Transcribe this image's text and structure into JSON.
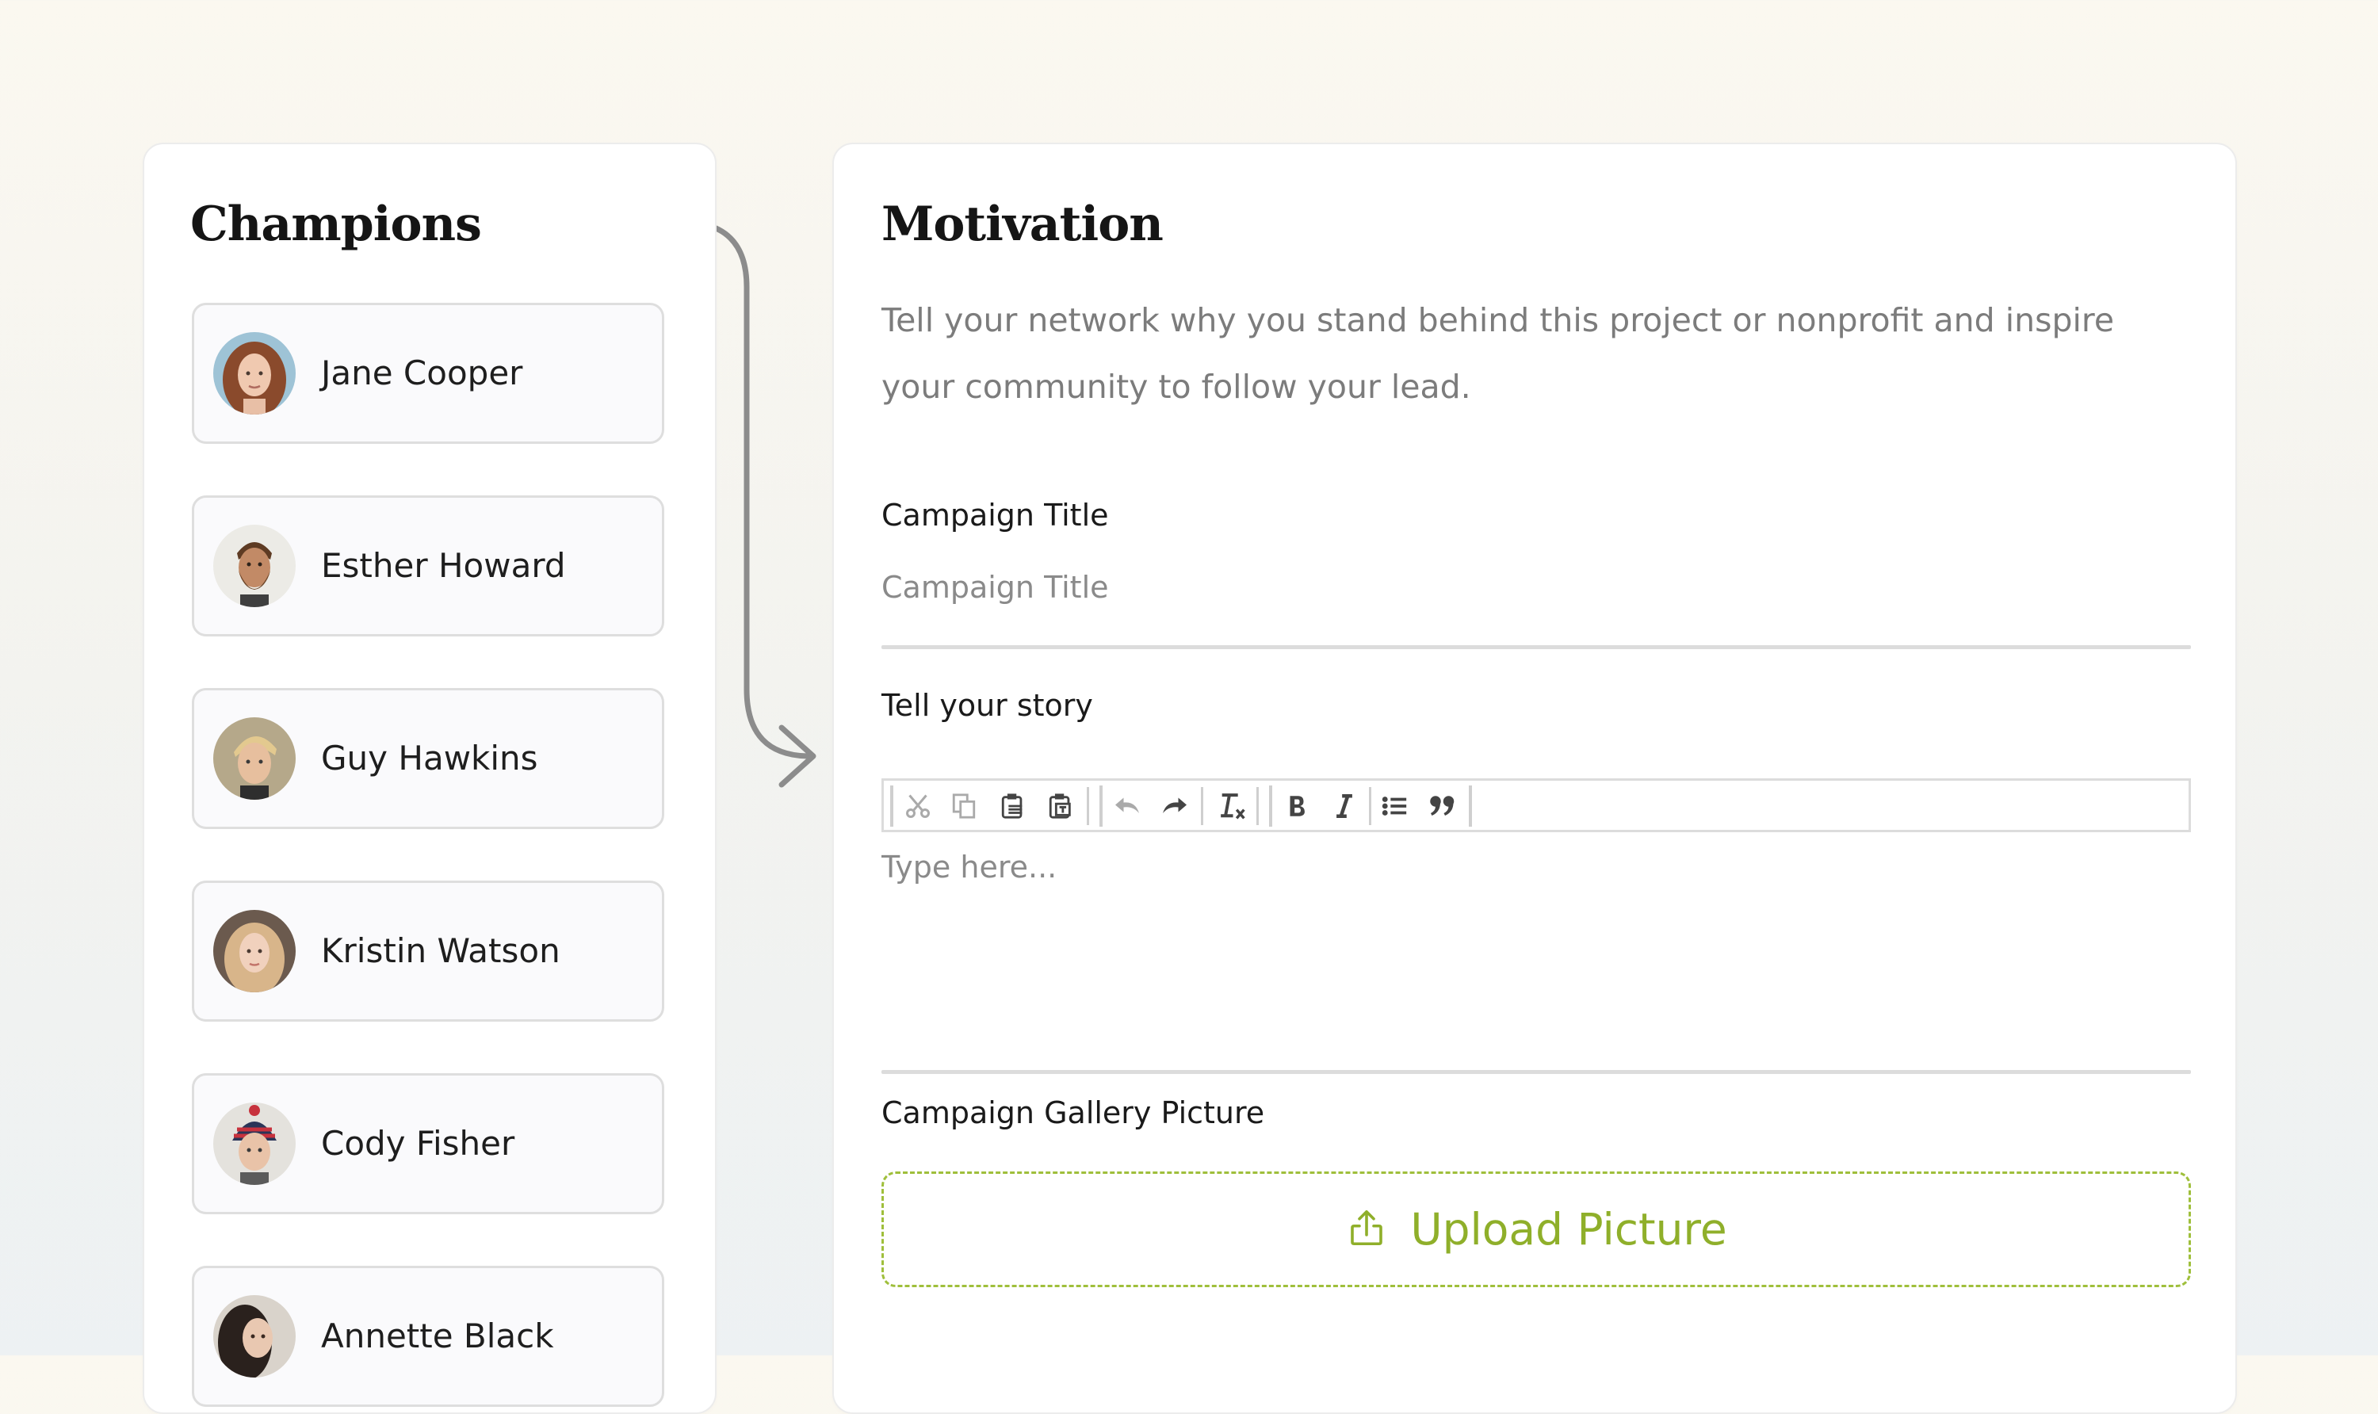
{
  "champions": {
    "title": "Champions",
    "people": [
      {
        "name": "Jane Cooper"
      },
      {
        "name": "Esther Howard"
      },
      {
        "name": "Guy Hawkins"
      },
      {
        "name": "Kristin Watson"
      },
      {
        "name": "Cody Fisher"
      },
      {
        "name": "Annette Black"
      }
    ]
  },
  "motivation": {
    "title": "Motivation",
    "intro": "Tell your network why you stand behind this project or nonprofit and inspire your community to follow your lead.",
    "campaign_title": {
      "label": "Campaign Title",
      "placeholder": "Campaign Title",
      "value": ""
    },
    "story": {
      "label": "Tell your story",
      "placeholder": "Type here...",
      "toolbar": [
        "cut-icon",
        "copy-icon",
        "paste-icon",
        "paste-text-icon",
        "undo-icon",
        "redo-icon",
        "remove-format-icon",
        "bold-icon",
        "italic-icon",
        "bulleted-list-icon",
        "blockquote-icon"
      ]
    },
    "gallery": {
      "label": "Campaign Gallery Picture",
      "upload_label": "Upload Picture"
    }
  },
  "colors": {
    "accent": "#8faf2a",
    "accent_border": "#9fbf3b",
    "muted_text": "#7c7c7c",
    "arrow": "#8c8c8c"
  }
}
